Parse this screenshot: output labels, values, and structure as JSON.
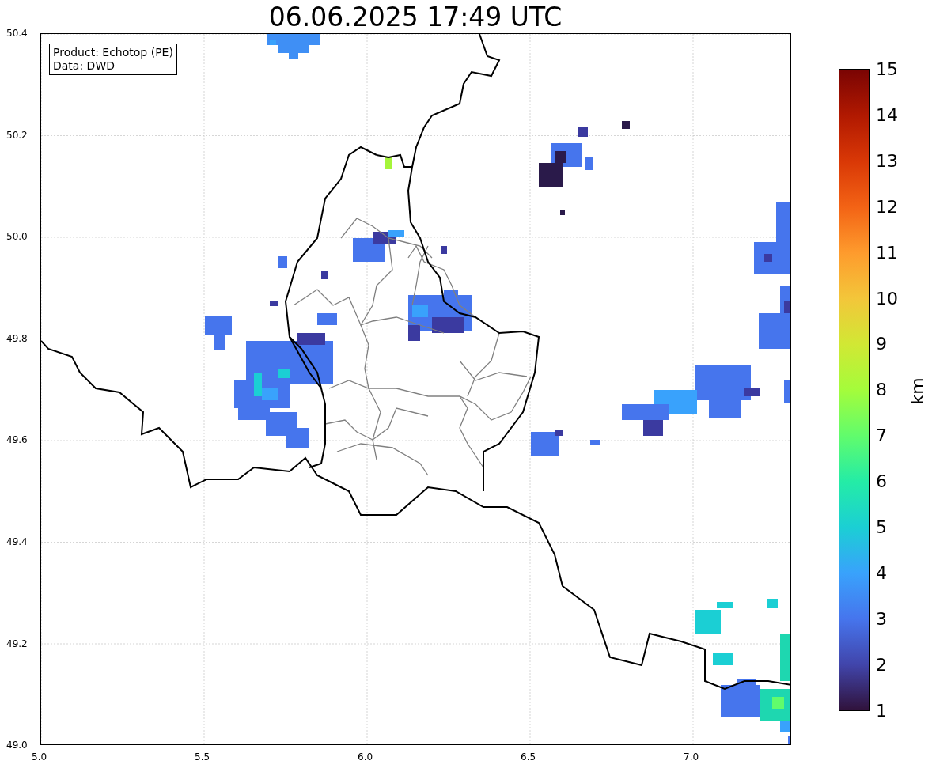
{
  "title": "06.06.2025 17:49 UTC",
  "info_box": {
    "lines": [
      "Product: Echotop (PE)",
      "Data: DWD"
    ]
  },
  "x_axis": {
    "ticks": [
      "5.0",
      "5.5",
      "6.0",
      "6.5",
      "7.0"
    ]
  },
  "y_axis": {
    "ticks": [
      "50.4",
      "50.2",
      "50.0",
      "49.8",
      "49.6",
      "49.4",
      "49.2",
      "49.0"
    ]
  },
  "colorbar": {
    "label": "km",
    "ticks": [
      "15",
      "14",
      "13",
      "12",
      "11",
      "10",
      "9",
      "8",
      "7",
      "6",
      "5",
      "4",
      "3",
      "2",
      "1"
    ]
  }
}
